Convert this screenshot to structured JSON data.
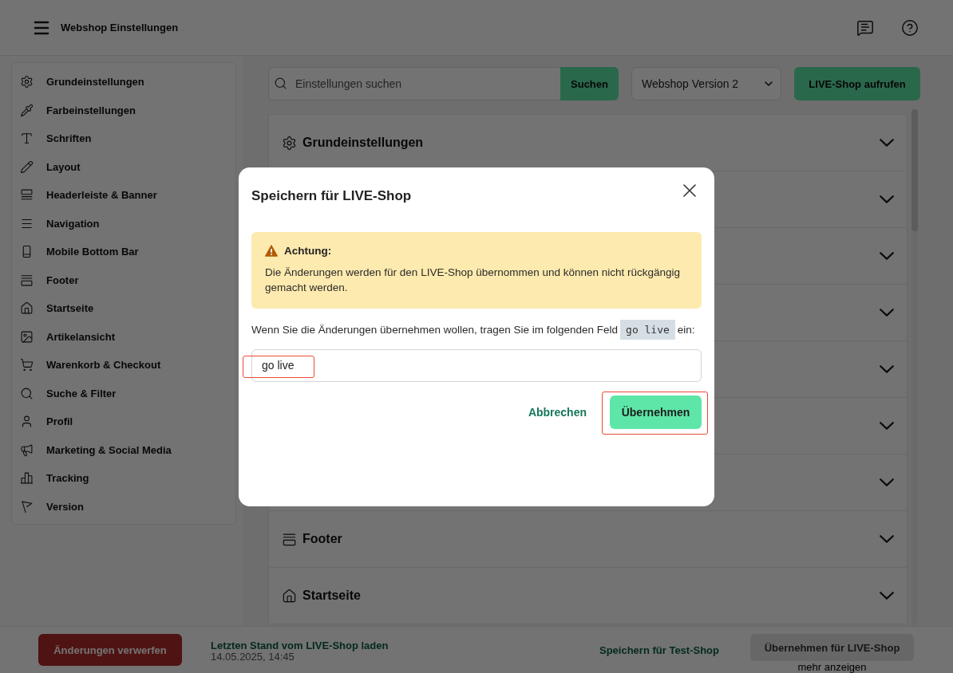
{
  "header": {
    "title": "Webshop Einstellungen"
  },
  "sidebar": {
    "items": [
      {
        "label": "Grundeinstellungen"
      },
      {
        "label": "Farbeinstellungen"
      },
      {
        "label": "Schriften"
      },
      {
        "label": "Layout"
      },
      {
        "label": "Headerleiste & Banner"
      },
      {
        "label": "Navigation"
      },
      {
        "label": "Mobile Bottom Bar"
      },
      {
        "label": "Footer"
      },
      {
        "label": "Startseite"
      },
      {
        "label": "Artikelansicht"
      },
      {
        "label": "Warenkorb & Checkout"
      },
      {
        "label": "Suche & Filter"
      },
      {
        "label": "Profil"
      },
      {
        "label": "Marketing & Social Media"
      },
      {
        "label": "Tracking"
      },
      {
        "label": "Version"
      }
    ]
  },
  "toolbar": {
    "search": {
      "placeholder": "Einstellungen suchen",
      "button": "Suchen"
    },
    "version_select": {
      "value": "Webshop Version 2"
    },
    "live_button": "LIVE-Shop aufrufen"
  },
  "sections": [
    {
      "title": "Grundeinstellungen",
      "expanded": false
    },
    {
      "expanded": false
    },
    {
      "expanded": false
    },
    {
      "expanded": false
    },
    {
      "expanded": false
    },
    {
      "expanded": false
    },
    {
      "expanded": false
    },
    {
      "title": "Footer",
      "expanded": false
    },
    {
      "title": "Startseite",
      "expanded": false
    }
  ],
  "footer_bar": {
    "discard_button": "Änderungen verwerfen",
    "reload_link": "Letzten Stand vom LIVE-Shop laden",
    "reload_time": "14.05.2025, 14:45",
    "save_test_button": "Speichern für Test-Shop",
    "apply_live_button": {
      "label": "Übernehmen für LIVE-Shop",
      "disabled": true
    },
    "more_link": "mehr anzeigen"
  },
  "dialog": {
    "title": "Speichern für LIVE-Shop",
    "warning": {
      "title": "Achtung:",
      "text": "Die Änderungen werden für den LIVE-Shop übernommen und können nicht rückgängig gemacht werden."
    },
    "instruction": {
      "text": "Wenn Sie die Änderungen übernehmen wollen, tragen Sie im folgenden Feld",
      "code": "go live",
      "suffix": "ein:"
    },
    "input": {
      "value": "go live",
      "highlighted": true
    },
    "cancel_button": "Abbrechen",
    "confirm_button": {
      "label": "Übernehmen",
      "highlighted": true
    }
  }
}
